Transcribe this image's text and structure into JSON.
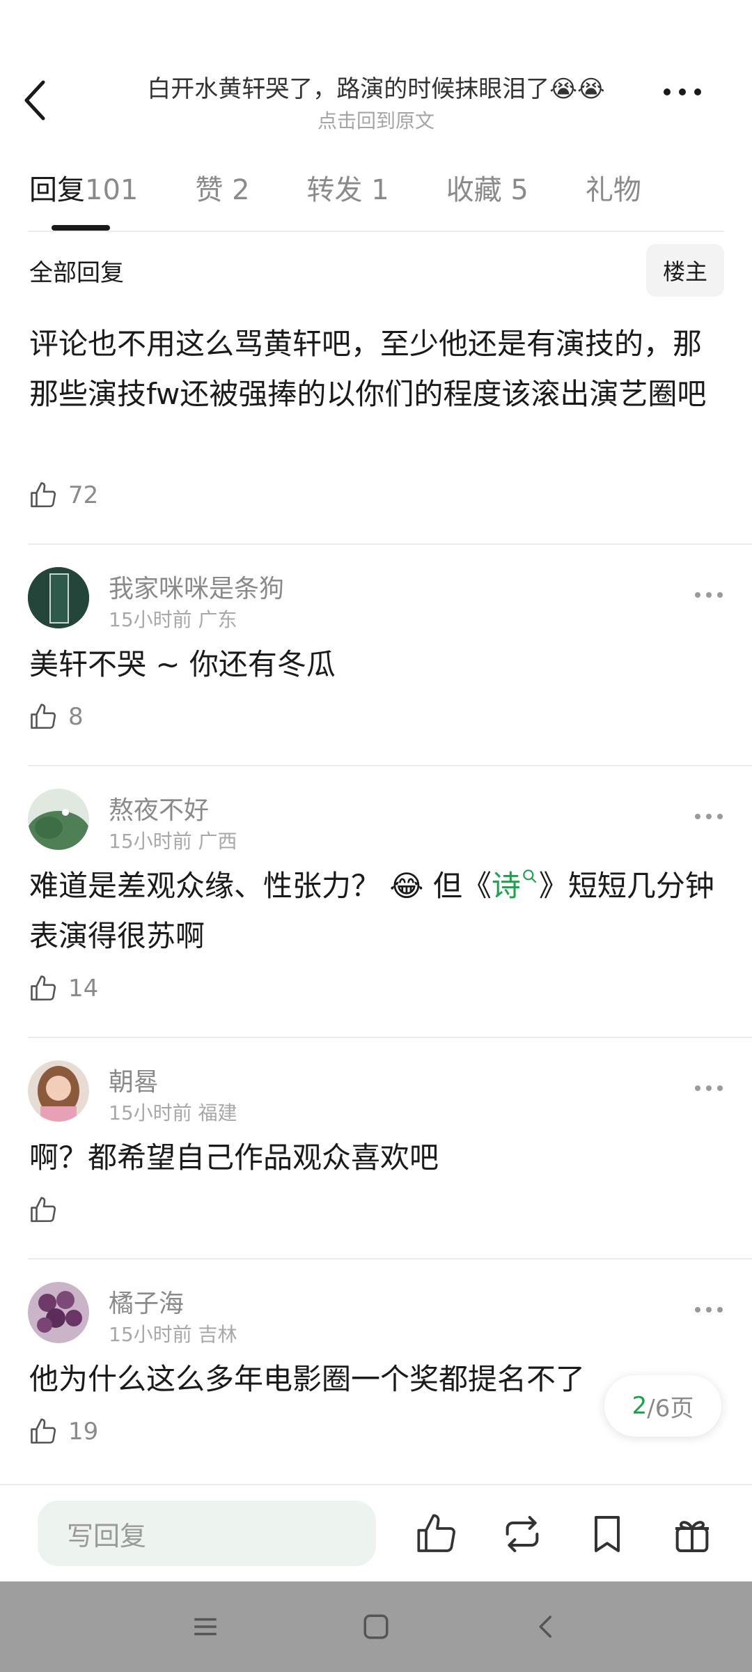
{
  "header": {
    "title": "白开水黄轩哭了，路演的时候抹眼泪了😭😭",
    "subtitle": "点击回到原文"
  },
  "tabs": [
    {
      "label": "回复",
      "count": "101"
    },
    {
      "label": "赞",
      "count": "2"
    },
    {
      "label": "转发",
      "count": "1"
    },
    {
      "label": "收藏",
      "count": "5"
    },
    {
      "label": "礼物",
      "count": ""
    }
  ],
  "filter": {
    "all_label": "全部回复",
    "owner_label": "楼主"
  },
  "main_comment": {
    "text": "评论也不用这么骂黄轩吧，至少他还是有演技的，那那些演技fw还被强捧的以你们的程度该滚出演艺圈吧",
    "likes": "72"
  },
  "comments": [
    {
      "username": "我家咪咪是条狗",
      "time": "15小时前",
      "region": "广东",
      "text": "美轩不哭 ~ 你还有冬瓜",
      "likes": "8"
    },
    {
      "username": "熬夜不好",
      "time": "15小时前",
      "region": "广西",
      "text_before": "难道是差观众缘、性张力？",
      "emoji": "😂",
      "text_mid": "但《",
      "link": "诗",
      "text_after": "》短短几分钟表演得很苏啊",
      "likes": "14"
    },
    {
      "username": "朝晷",
      "time": "15小时前",
      "region": "福建",
      "text": "啊？都希望自己作品观众喜欢吧",
      "likes": ""
    },
    {
      "username": "橘子海",
      "time": "15小时前",
      "region": "吉林",
      "text": "他为什么这么多年电影圈一个奖都提名不了",
      "likes": "19"
    }
  ],
  "pagination": {
    "current": "2",
    "total_label": "/6页"
  },
  "bottom_bar": {
    "reply_placeholder": "写回复",
    "icons": [
      "like-icon",
      "repost-icon",
      "bookmark-icon",
      "gift-icon"
    ]
  },
  "system_nav": {
    "icons": [
      "menu-icon",
      "home-icon",
      "back-icon"
    ]
  },
  "colors": {
    "accent_green": "#19a34a",
    "text_primary": "#1a1a1a",
    "text_secondary": "#8a8a8a",
    "divider": "#ececec"
  }
}
